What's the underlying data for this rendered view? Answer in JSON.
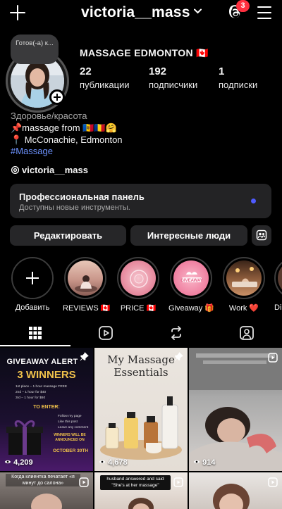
{
  "header": {
    "username": "victoria__mass",
    "notification_count": "3"
  },
  "profile": {
    "note": "Готов(-а) к...",
    "display_name": "MASSAGE EDMONTON 🇨🇦",
    "stats": [
      {
        "value": "22",
        "label": "публикации"
      },
      {
        "value": "192",
        "label": "подписчики"
      },
      {
        "value": "1",
        "label": "подписки"
      }
    ],
    "category": "Здоровье/красота",
    "bio_line1": "📌massage from 🇲🇩🇷🇴🤗",
    "bio_line2": "📍 McConachie, Edmonton",
    "hashtag": "#Massage",
    "threads_handle": "victoria__mass"
  },
  "pro_panel": {
    "title": "Профессиональная панель",
    "subtitle": "Доступны новые инструменты."
  },
  "buttons": {
    "edit": "Редактировать",
    "discover": "Интересные люди"
  },
  "highlights": [
    {
      "label": "Добавить"
    },
    {
      "label": "REVIEWS 🇨🇦"
    },
    {
      "label": "PRICE 🇨🇦"
    },
    {
      "label": "Giveaway 🎁"
    },
    {
      "label": "Work ❤️"
    },
    {
      "label": "Di"
    }
  ],
  "posts": [
    {
      "views": "4,209",
      "title": "GIVEAWAY ALERT",
      "subtitle": "3 WINNERS",
      "lines": [
        "1st place – 1 hour massage FREE",
        "2nd – 1 hour for $40",
        "3rd – 1 hour for $60"
      ],
      "to_enter": "TO ENTER:",
      "enter_items": [
        "Follow my page",
        "Like this post",
        "Leave any comment"
      ],
      "winners": "WINNERS WILL BE ANNOUNCED ON",
      "date": "OCTOBER 30TH"
    },
    {
      "views": "4,678",
      "title": "My Massage Essentials"
    },
    {
      "views": "914"
    },
    {
      "caption": "Когда клиентка печатает «я минут до салона»"
    },
    {
      "caption": "husband answered and said \"She's at her massage\""
    },
    {}
  ]
}
